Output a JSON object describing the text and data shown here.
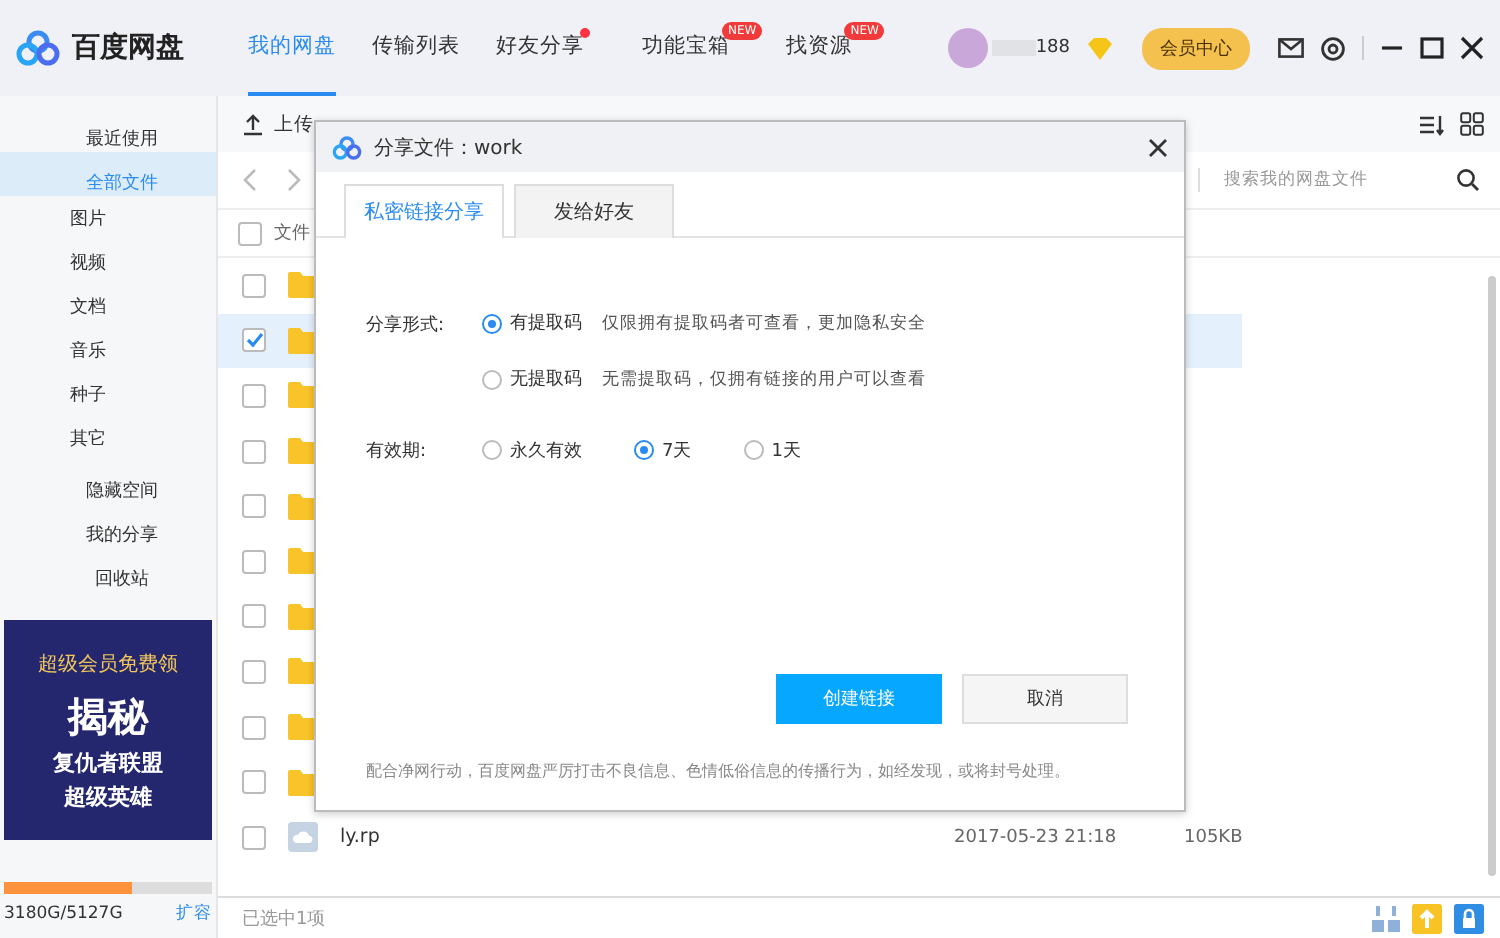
{
  "app": {
    "name": "百度网盘",
    "user": "188"
  },
  "nav_tabs": [
    {
      "label": "我的网盘",
      "selected": true
    },
    {
      "label": "传输列表",
      "selected": false
    },
    {
      "label": "好友分享",
      "selected": false,
      "dot": true
    },
    {
      "label": "功能宝箱",
      "selected": false,
      "badge": "NEW"
    },
    {
      "label": "找资源",
      "selected": false,
      "badge": "NEW"
    }
  ],
  "vip_button": "会员中心",
  "sidebar": {
    "items": [
      {
        "label": "最近使用",
        "kind": "main",
        "selected": false
      },
      {
        "label": "全部文件",
        "kind": "main",
        "selected": true
      },
      {
        "label": "图片",
        "kind": "sub",
        "selected": false
      },
      {
        "label": "视频",
        "kind": "sub",
        "selected": false
      },
      {
        "label": "文档",
        "kind": "sub",
        "selected": false
      },
      {
        "label": "音乐",
        "kind": "sub",
        "selected": false
      },
      {
        "label": "种子",
        "kind": "sub",
        "selected": false
      },
      {
        "label": "其它",
        "kind": "sub",
        "selected": false
      },
      {
        "label": "隐藏空间",
        "kind": "main",
        "selected": false
      },
      {
        "label": "我的分享",
        "kind": "main",
        "selected": false
      },
      {
        "label": "回收站",
        "kind": "main",
        "selected": false
      }
    ],
    "banner": {
      "line_1": "超级会员免费领",
      "line_2": "揭秘",
      "line_3": "复仇者联盟",
      "line_4": "超级英雄"
    },
    "storage": {
      "level": 0.62,
      "text": "3180G/5127G",
      "expand": "扩容"
    }
  },
  "toolbar": {
    "upload": "上传"
  },
  "search": {
    "placeholder": "搜索我的网盘文件"
  },
  "file_list": {
    "column_1": "文件",
    "select_all": {
      "checked": false
    },
    "rows": [
      {
        "kind": "folder",
        "checked": false
      },
      {
        "kind": "folder",
        "checked": true
      },
      {
        "kind": "folder",
        "checked": false
      },
      {
        "kind": "folder",
        "checked": false
      },
      {
        "kind": "folder",
        "checked": false
      },
      {
        "kind": "folder",
        "checked": false
      },
      {
        "kind": "folder",
        "checked": false
      },
      {
        "kind": "folder",
        "checked": false
      },
      {
        "kind": "folder",
        "checked": false
      },
      {
        "kind": "folder",
        "checked": false
      },
      {
        "kind": "file",
        "checked": false,
        "name": "ly.rp",
        "date": "2017-05-23 21:18",
        "size": "105KB"
      }
    ]
  },
  "status_bar": {
    "text": "已选中1项"
  },
  "dialog": {
    "title": "分享文件：work",
    "tabs": [
      {
        "label": "私密链接分享",
        "selected": true
      },
      {
        "label": "发给好友",
        "selected": false
      }
    ],
    "share_form": {
      "label": "分享形式:",
      "options": [
        {
          "label": "有提取码",
          "hint": "仅限拥有提取码者可查看，更加隐私安全",
          "selected": true
        },
        {
          "label": "无提取码",
          "hint": "无需提取码，仅拥有链接的用户可以查看",
          "selected": false
        }
      ]
    },
    "validity": {
      "label": "有效期:",
      "options": [
        {
          "label": "永久有效",
          "selected": false
        },
        {
          "label": "7天",
          "selected": true
        },
        {
          "label": "1天",
          "selected": false
        }
      ]
    },
    "buttons": [
      {
        "label": "创建链接",
        "kind": "primary"
      },
      {
        "label": "取消",
        "kind": "secondary"
      }
    ],
    "notice": "配合净网行动，百度网盘严厉打击不良信息、色情低俗信息的传播行为，如经发现，或将封号处理。"
  }
}
